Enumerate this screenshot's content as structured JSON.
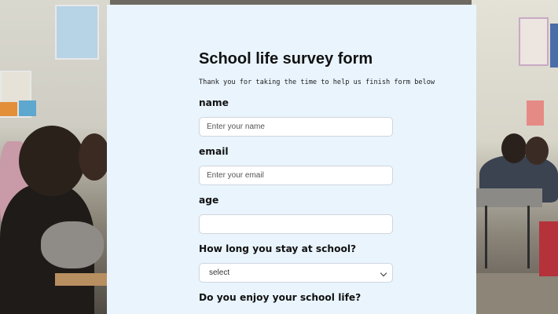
{
  "form": {
    "title": "School life survey form",
    "subtitle": "Thank you for taking the time to help us finish form below",
    "fields": {
      "name": {
        "label": "name",
        "placeholder": "Enter your name",
        "value": ""
      },
      "email": {
        "label": "email",
        "placeholder": "Enter your email",
        "value": ""
      },
      "age": {
        "label": "age",
        "placeholder": "",
        "value": ""
      }
    },
    "stay_question": {
      "label": "How long you stay at school?",
      "selected": "select"
    },
    "enjoy_question": {
      "label": "Do you enjoy your school life?"
    }
  },
  "colors": {
    "panel_background": "#e9f4fd",
    "input_border": "#cfd6de"
  }
}
